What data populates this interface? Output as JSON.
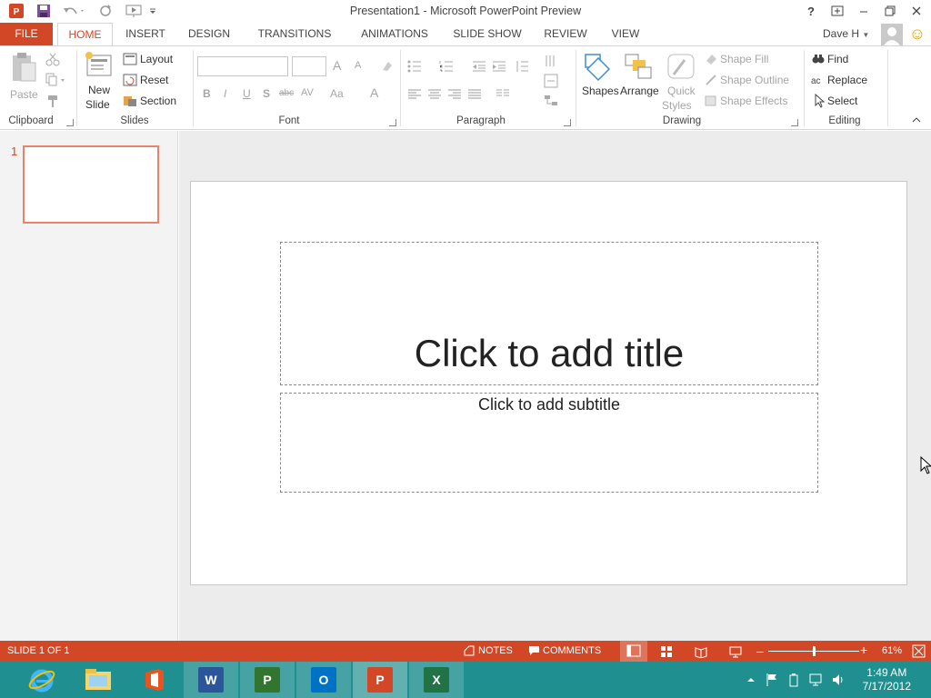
{
  "window": {
    "title": "Presentation1 - Microsoft PowerPoint Preview"
  },
  "quick_access": {
    "save": "save-icon",
    "undo": "undo-icon",
    "redo": "redo-icon",
    "start_from_beginning": "present-icon",
    "customize": "customize-icon"
  },
  "window_controls": {
    "help": "?",
    "ribbon_display": "ribbon-display-icon",
    "minimize": "minimize-icon",
    "restore": "restore-icon",
    "close": "close-icon"
  },
  "tabs": [
    {
      "label": "FILE"
    },
    {
      "label": "HOME"
    },
    {
      "label": "INSERT"
    },
    {
      "label": "DESIGN"
    },
    {
      "label": "TRANSITIONS"
    },
    {
      "label": "ANIMATIONS"
    },
    {
      "label": "SLIDE SHOW"
    },
    {
      "label": "REVIEW"
    },
    {
      "label": "VIEW"
    }
  ],
  "user": {
    "name": "Dave H",
    "emoji": "☺"
  },
  "ribbon": {
    "clipboard": {
      "label": "Clipboard",
      "paste": "Paste"
    },
    "slides": {
      "label": "Slides",
      "new_slide_1": "New",
      "new_slide_2": "Slide",
      "layout": "Layout",
      "reset": "Reset",
      "section": "Section"
    },
    "font": {
      "label": "Font",
      "bold": "B",
      "italic": "I",
      "underline": "U",
      "shadow": "S",
      "strike": "abc",
      "spacing": "AV",
      "case": "Aa",
      "color": "A",
      "grow": "A",
      "shrink": "A"
    },
    "paragraph": {
      "label": "Paragraph"
    },
    "drawing": {
      "label": "Drawing",
      "shapes": "Shapes",
      "arrange": "Arrange",
      "quick_styles_1": "Quick",
      "quick_styles_2": "Styles",
      "shape_fill": "Shape Fill",
      "shape_outline": "Shape Outline",
      "shape_effects": "Shape Effects"
    },
    "editing": {
      "label": "Editing",
      "find": "Find",
      "replace": "Replace",
      "select": "Select"
    }
  },
  "thumbnails": [
    {
      "number": "1"
    }
  ],
  "slide": {
    "title_placeholder": "Click to add title",
    "subtitle_placeholder": "Click to add subtitle"
  },
  "status": {
    "slide_info": "SLIDE 1 OF 1",
    "notes": "NOTES",
    "comments": "COMMENTS",
    "zoom": "61%",
    "zoom_fraction": 0.5
  },
  "taskbar": {
    "apps": [
      {
        "name": "Internet Explorer",
        "icon": "ie-icon"
      },
      {
        "name": "File Explorer",
        "icon": "folder-icon"
      },
      {
        "name": "Office",
        "icon": "office-icon"
      },
      {
        "name": "Word",
        "icon": "word-icon",
        "letter": "W"
      },
      {
        "name": "Project",
        "icon": "project-icon",
        "letter": "P"
      },
      {
        "name": "Outlook",
        "icon": "outlook-icon",
        "letter": "O"
      },
      {
        "name": "PowerPoint",
        "icon": "powerpoint-icon",
        "letter": "P"
      },
      {
        "name": "Excel",
        "icon": "excel-icon",
        "letter": "X"
      }
    ],
    "time": "1:49 AM",
    "date": "7/17/2012"
  },
  "colors": {
    "accent": "#d24726",
    "taskbar": "#1f8f8f"
  }
}
